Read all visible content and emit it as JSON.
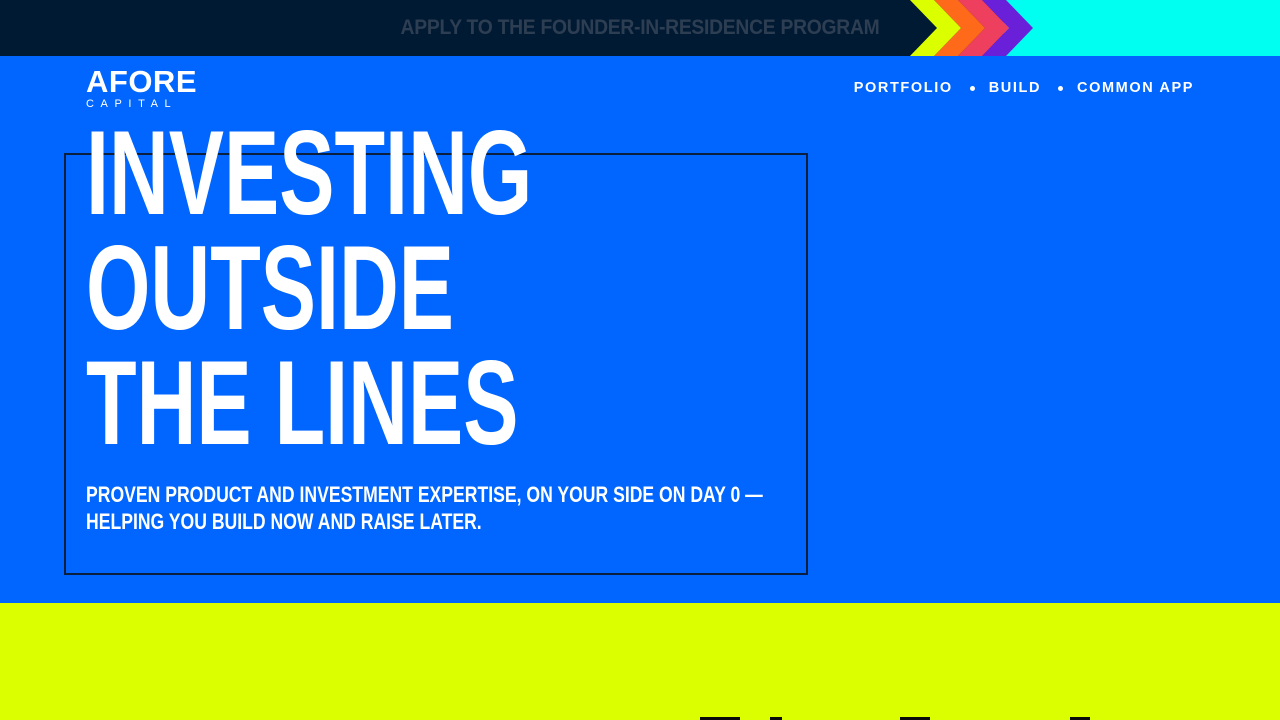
{
  "banner": {
    "text": "APPLY TO THE FOUNDER-IN-RESIDENCE PROGRAM",
    "chevron_colors": [
      "#dcff00",
      "#ff6a1a",
      "#ef3f5e",
      "#6a1fd8"
    ],
    "accent_color": "#00fff0"
  },
  "header": {
    "logo_main": "AFORE",
    "logo_sub": "CAPITAL",
    "nav": [
      {
        "label": "PORTFOLIO"
      },
      {
        "label": "BUILD"
      },
      {
        "label": "COMMON APP"
      }
    ]
  },
  "hero": {
    "headline_lines": [
      "INVESTING",
      "OUTSIDE",
      "THE LINES"
    ],
    "subtext_lines": [
      "PROVEN PRODUCT AND INVESTMENT EXPERTISE, ON YOUR SIDE ON DAY 0 —",
      "HELPING YOU BUILD NOW AND RAISE LATER."
    ]
  },
  "colors": {
    "hero_bg": "#0066ff",
    "banner_bg": "#001a33",
    "lower_bg": "#dcff00",
    "frame": "#0b1f3f",
    "text": "#ffffff"
  }
}
